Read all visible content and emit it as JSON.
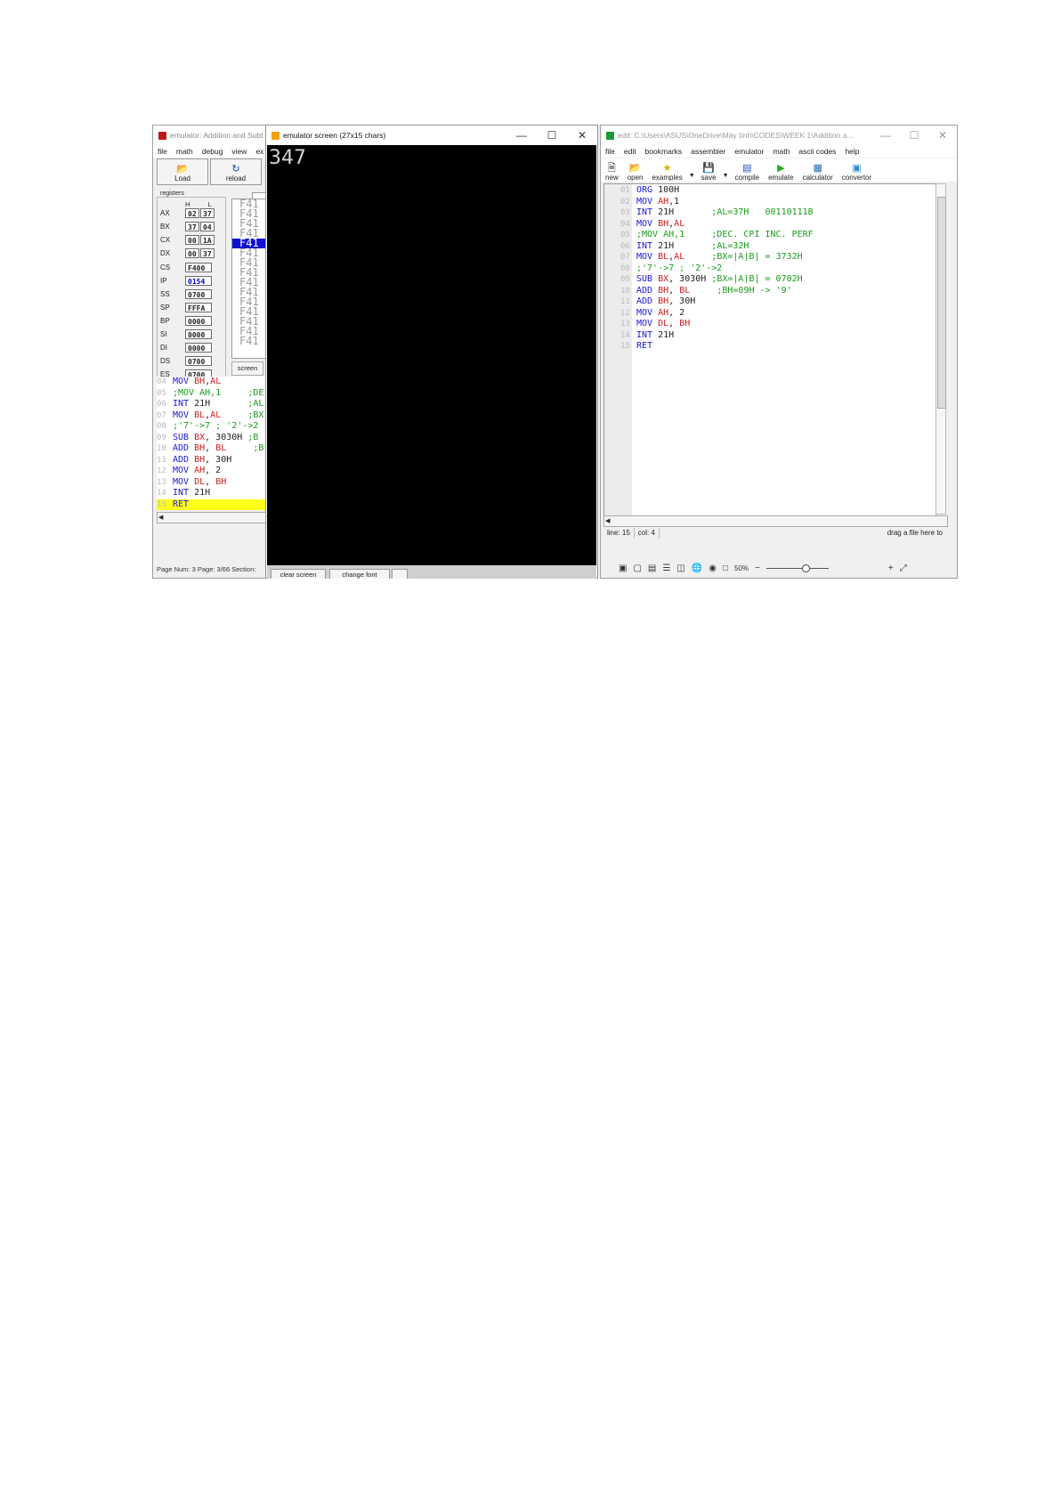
{
  "emulator": {
    "title": "emulator: Addition and Subt",
    "menu": [
      "file",
      "math",
      "debug",
      "view",
      "ex"
    ],
    "toolbar": {
      "load": "Load",
      "reload": "reload"
    },
    "registers_label": "registers",
    "hl_label": "H L",
    "registers": [
      {
        "name": "AX",
        "h": "02",
        "l": "37"
      },
      {
        "name": "BX",
        "h": "37",
        "l": "04"
      },
      {
        "name": "CX",
        "h": "00",
        "l": "1A"
      },
      {
        "name": "DX",
        "h": "00",
        "l": "37"
      }
    ],
    "segments": [
      {
        "name": "CS",
        "value": "F400"
      },
      {
        "name": "IP",
        "value": "0154"
      },
      {
        "name": "SS",
        "value": "0700"
      },
      {
        "name": "SP",
        "value": "FFFA"
      },
      {
        "name": "BP",
        "value": "0000"
      },
      {
        "name": "SI",
        "value": "0000"
      },
      {
        "name": "DI",
        "value": "0000"
      },
      {
        "name": "DS",
        "value": "0700"
      },
      {
        "name": "ES",
        "value": "0700"
      }
    ],
    "memory_items": [
      "F41",
      "F41",
      "F41",
      "F41",
      "F41",
      "F41",
      "F41",
      "F41",
      "F41",
      "F41",
      "F41",
      "F41",
      "F41",
      "F41",
      "F41"
    ],
    "memory_selected_index": 4,
    "screen_button": "screen",
    "code_lines": [
      {
        "n": "04",
        "text": "MOV BH,AL"
      },
      {
        "n": "05",
        "text": ";MOV AH,1     ;DE"
      },
      {
        "n": "06",
        "text": "INT 21H       ;AL"
      },
      {
        "n": "07",
        "text": "MOV BL,AL     ;BX"
      },
      {
        "n": "08",
        "text": ";'7'->7 ; '2'->2"
      },
      {
        "n": "09",
        "text": "SUB BX, 3030H ;B"
      },
      {
        "n": "10",
        "text": "ADD BH, BL     ;B"
      },
      {
        "n": "11",
        "text": "ADD BH, 30H"
      },
      {
        "n": "12",
        "text": "MOV AH, 2"
      },
      {
        "n": "13",
        "text": "MOV DL, BH"
      },
      {
        "n": "14",
        "text": "INT 21H"
      },
      {
        "n": "15",
        "text": "RET"
      }
    ],
    "word_status": "Page Num: 3   Page: 3/66   Section:"
  },
  "screen": {
    "title": "emulator screen (27x15 chars)",
    "output": "347",
    "clear_screen": "clear screen",
    "change_font": "change font"
  },
  "editor": {
    "title": "edit: C:\\Users\\ASUS\\OneDrive\\Máy tính\\CODES\\WEEK 1\\Addition a...",
    "menu": [
      "file",
      "edit",
      "bookmarks",
      "assembler",
      "emulator",
      "math",
      "ascii codes",
      "help"
    ],
    "toolbar": [
      "new",
      "open",
      "examples",
      "save",
      "compile",
      "emulate",
      "calculator",
      "convertor"
    ],
    "code_lines": [
      {
        "n": "01",
        "text": "ORG 100H"
      },
      {
        "n": "02",
        "text": "MOV AH,1"
      },
      {
        "n": "03",
        "text": "INT 21H       ;AL=37H   00110111B"
      },
      {
        "n": "04",
        "text": "MOV BH,AL"
      },
      {
        "n": "05",
        "text": ";MOV AH,1     ;DEC. CPI INC. PERF"
      },
      {
        "n": "06",
        "text": "INT 21H       ;AL=32H"
      },
      {
        "n": "07",
        "text": "MOV BL,AL     ;BX=|A|B| = 3732H"
      },
      {
        "n": "08",
        "text": ";'7'->7 ; '2'->2"
      },
      {
        "n": "09",
        "text": "SUB BX, 3030H ;BX=|A|B| = 0702H"
      },
      {
        "n": "10",
        "text": "ADD BH, BL     ;BH=09H -> '9'"
      },
      {
        "n": "11",
        "text": "ADD BH, 30H"
      },
      {
        "n": "12",
        "text": "MOV AH, 2"
      },
      {
        "n": "13",
        "text": "MOV DL, BH"
      },
      {
        "n": "14",
        "text": "INT 21H"
      },
      {
        "n": "15",
        "text": "RET"
      }
    ],
    "status_line": "line: 15",
    "status_col": "col: 4",
    "status_drag": "drag a file here to",
    "zoom": "50%"
  },
  "colors": {
    "keyword": "#1a1ad2",
    "register": "#cc1d1d",
    "comment": "#1a9a1a",
    "highlight": "#ffff1a",
    "selection": "#1010d0"
  }
}
